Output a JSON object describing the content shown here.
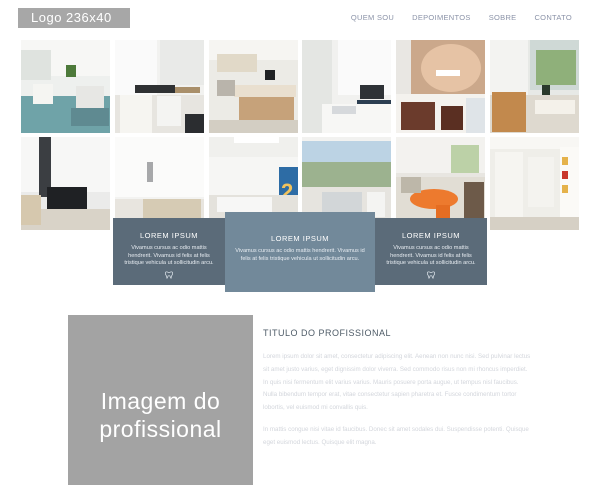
{
  "header": {
    "logo_text": "Logo 236x40",
    "nav": [
      "QUEM SOU",
      "DEPOIMENTOS",
      "SOBRE",
      "CONTATO"
    ]
  },
  "cards": [
    {
      "title": "LOREM IPSUM",
      "text": "Vivamus cursus ac odio mattis hendrerit. Vivamus id felis at felis tristique vehicula ut sollicitudin arcu.",
      "icon": "tooth-icon"
    },
    {
      "title": "LOREM IPSUM",
      "text": "Vivamus cursus ac odio mattis hendrerit. Vivamus id felis at felis tristique vehicula ut sollicitudin arcu.",
      "icon": "none"
    },
    {
      "title": "LOREM IPSUM",
      "text": "Vivamus cursus ac odio mattis hendrerit. Vivamus id felis at felis tristique vehicula ut sollicitudin arcu.",
      "icon": "tooth-icon"
    }
  ],
  "professional": {
    "image_placeholder": "Imagem do profissional",
    "title": "TITULO DO PROFISSIONAL",
    "paragraphs": [
      "Lorem ipsum dolor sit amet, consectetur adipiscing elit. Aenean non nunc nisi. Sed pulvinar lectus sit amet justo varius, eget dignissim dolor viverra. Sed commodo risus non mi rhoncus imperdiet. In quis nisi fermentum elit varius varius. Mauris posuere porta augue, ut tempus nisl faucibus. Nulla bibendum tempor erat, vitae consectetur sapien pharetra et. Fusce condimentum tortor lobortis, vel euismod mi convallis quis.",
      "In mattis congue nisi vitae id faucibus. Donec sit amet sodales dui. Suspendisse potenti. Quisque eget euismod lectus. Quisque elit magna."
    ]
  },
  "colors": {
    "logo_bg": "#a7a7a7",
    "nav_text": "#8b93a8",
    "card_dark": "#5b6b79",
    "card_light": "#72899a",
    "title_text": "#4e5b67",
    "body_text": "#d3d6dc"
  }
}
